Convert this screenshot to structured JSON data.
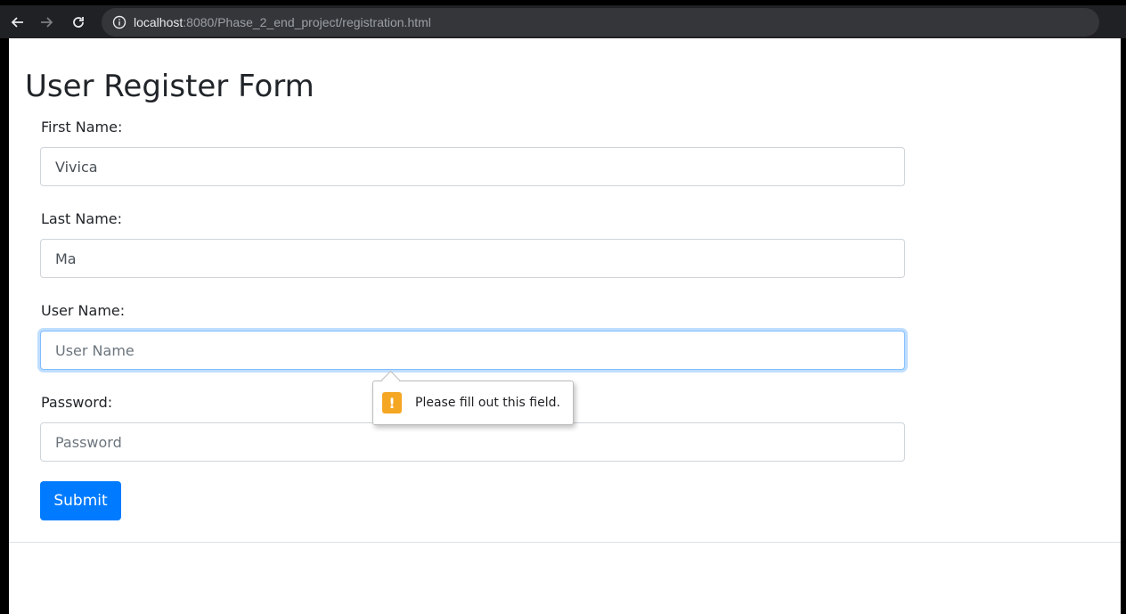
{
  "browser": {
    "url_host": "localhost",
    "url_path": ":8080/Phase_2_end_project/registration.html",
    "icons": {
      "back": "back-arrow-icon",
      "forward": "forward-arrow-icon",
      "reload": "reload-icon",
      "info": "info-icon"
    }
  },
  "form": {
    "title": "User Register Form",
    "first_name": {
      "label": "First Name:",
      "value": "Vivica",
      "placeholder": ""
    },
    "last_name": {
      "label": "Last Name:",
      "value": "Ma",
      "placeholder": ""
    },
    "user_name": {
      "label": "User Name:",
      "value": "",
      "placeholder": "User Name"
    },
    "password": {
      "label": "Password:",
      "value": "",
      "placeholder": "Password"
    },
    "submit_label": "Submit"
  },
  "validation_tooltip": {
    "icon": "warning-icon",
    "icon_glyph": "!",
    "message": "Please fill out this field."
  },
  "colors": {
    "primary": "#007bff",
    "focus_border": "#80bdff",
    "warning": "#f5a623"
  }
}
